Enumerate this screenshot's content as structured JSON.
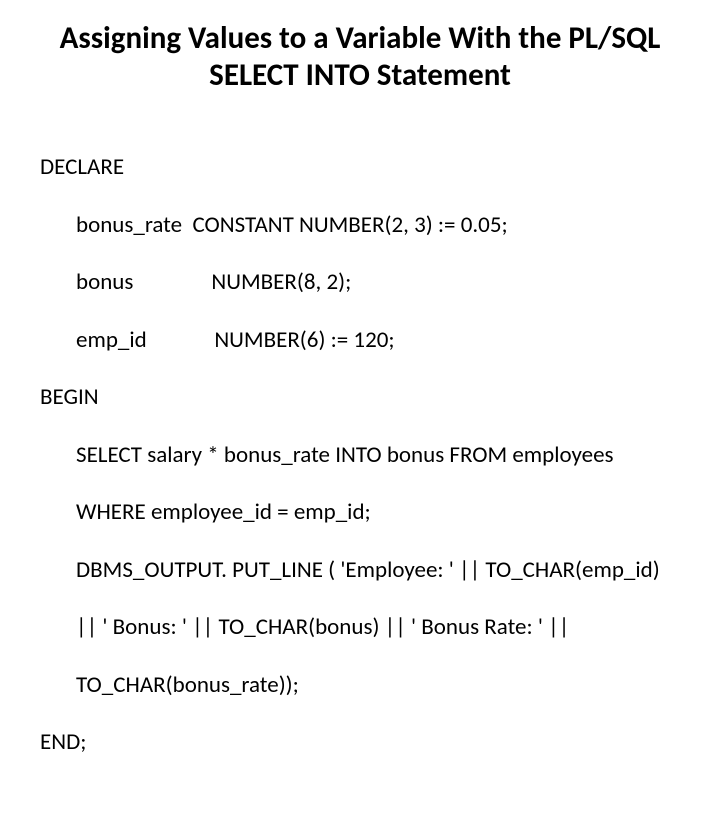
{
  "title_line1": "Assigning Values to a Variable With the PL/SQL",
  "title_line2": "SELECT INTO Statement",
  "code": {
    "l1": "DECLARE",
    "l2": "bonus_rate  CONSTANT NUMBER(2, 3) := 0.05;",
    "l3": "bonus               NUMBER(8, 2);",
    "l4": "emp_id             NUMBER(6) := 120;",
    "l5": "BEGIN",
    "l6": "SELECT salary * bonus_rate INTO bonus FROM employees",
    "l7": "WHERE employee_id = emp_id;",
    "l8": "DBMS_OUTPUT. PUT_LINE ( 'Employee: ' || TO_CHAR(emp_id)",
    "l9": "|| ' Bonus: ' || TO_CHAR(bonus) || ' Bonus Rate: ' ||",
    "l10": "TO_CHAR(bonus_rate));",
    "l11": "END;"
  }
}
